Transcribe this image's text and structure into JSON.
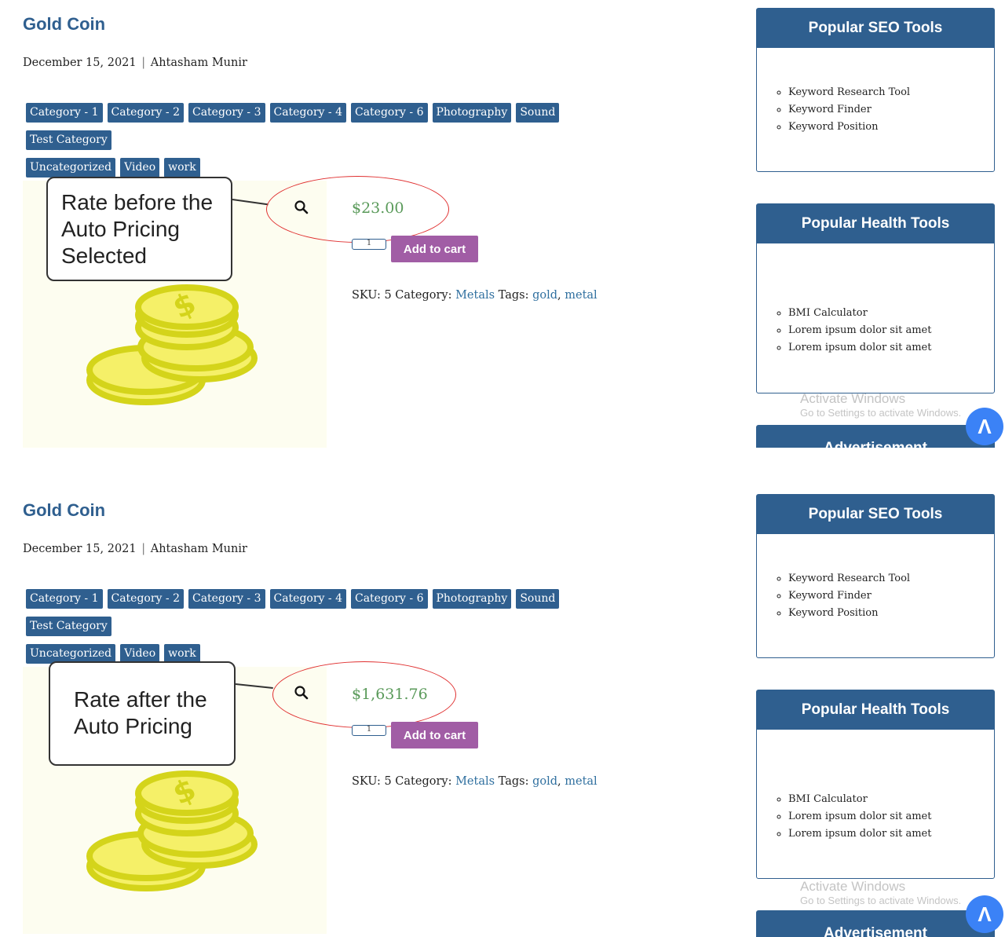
{
  "panels": {
    "top": {
      "product": {
        "title": "Gold Coin",
        "date": "December 15, 2021",
        "meta_separator": "|",
        "author": "Ahtasham Munir",
        "price": "$23.00",
        "quantity": "1",
        "add_to_cart": "Add to cart",
        "sku_label": "SKU:",
        "sku": "5",
        "category_label": "Category:",
        "category": "Metals",
        "tags_label": "Tags:",
        "tag1": "gold",
        "tag_separator": ",",
        "tag2": "metal"
      },
      "annotation": {
        "callout_text": "Rate before the Auto Pricing Selected"
      }
    },
    "bottom": {
      "product": {
        "title": "Gold Coin",
        "date": "December 15, 2021",
        "meta_separator": "|",
        "author": "Ahtasham Munir",
        "price": "$1,631.76",
        "quantity": "1",
        "add_to_cart": "Add to cart",
        "sku_label": "SKU:",
        "sku": "5",
        "category_label": "Category:",
        "category": "Metals",
        "tags_label": "Tags:",
        "tag1": "gold",
        "tag_separator": ",",
        "tag2": "metal"
      },
      "annotation": {
        "callout_text": "Rate after the Auto Pricing"
      }
    }
  },
  "categories": [
    "Category - 1",
    "Category - 2",
    "Category - 3",
    "Category - 4",
    "Category - 6",
    "Photography",
    "Sound",
    "Test Category",
    "Uncategorized",
    "Video",
    "work"
  ],
  "sidebar": {
    "seo": {
      "title": "Popular SEO Tools",
      "items": [
        "Keyword Research Tool",
        "Keyword Finder",
        "Keyword Position"
      ]
    },
    "health": {
      "title": "Popular Health Tools",
      "items": [
        "BMI Calculator",
        "Lorem ipsum dolor sit amet",
        "Lorem ipsum dolor sit amet"
      ]
    },
    "advertisement": {
      "title": "Advertisement"
    }
  },
  "windows_watermark": {
    "title": "Activate Windows",
    "subtitle": "Go to Settings to activate Windows."
  },
  "scroll_top": {
    "label": "Λ"
  },
  "icons": {
    "zoom": "magnifier-icon",
    "product_image": "gold-coins-stack-icon",
    "scroll_top": "chevron-up-icon"
  },
  "colors": {
    "brand_blue": "#2f5f8f",
    "add_to_cart": "#a15da5",
    "price_green": "#5a9a5a",
    "annotation_red": "#e03030",
    "coin_yellow": "#f5f068",
    "coin_outline": "#d4d41a",
    "scroll_top_blue": "#3b82f6"
  }
}
